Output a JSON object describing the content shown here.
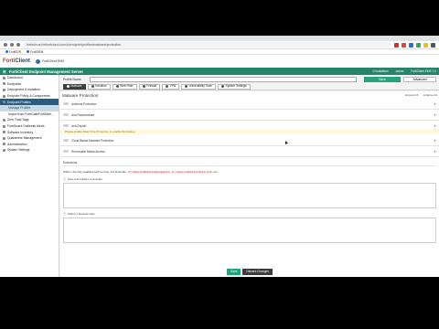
{
  "browser": {
    "url": "fortiedr.us.fortinetcloud.com/#/endpoint/profiles/malware/protection",
    "bookmarks": [
      "FortiEDR",
      "FortiSIEM"
    ]
  },
  "app": {
    "logo_prefix": "Forti",
    "logo_suffix": "Client",
    "ems_pill": "FortiClient EMS",
    "title": "FortiClient Endpoint Management Server",
    "header_right": [
      "0 Invitations",
      "admin",
      "FortiClient EMS 7.0"
    ]
  },
  "sidebar": {
    "items": [
      {
        "label": "Dashboard",
        "type": "item"
      },
      {
        "label": "Endpoints",
        "type": "item"
      },
      {
        "label": "Deployment & Installers",
        "type": "item"
      },
      {
        "label": "Endpoint Policy & Components",
        "type": "item"
      },
      {
        "label": "Endpoint Profiles",
        "type": "active"
      },
      {
        "label": "Manage Profiles",
        "type": "selected"
      },
      {
        "label": "Import from FortiGate/FortiMan...",
        "type": "sub"
      },
      {
        "label": "Zero Trust Tags",
        "type": "item"
      },
      {
        "label": "FortiGuard Outbreak Alerts",
        "type": "item"
      },
      {
        "label": "Software Inventory",
        "type": "item"
      },
      {
        "label": "Quarantine Management",
        "type": "item"
      },
      {
        "label": "Administration",
        "type": "item"
      },
      {
        "label": "System Settings",
        "type": "item"
      }
    ]
  },
  "profile": {
    "name_label": "Profile Name",
    "save_label": "Save",
    "advanced_label": "Advanced"
  },
  "tabs": [
    {
      "label": "Malware",
      "active": true
    },
    {
      "label": "Sandbox",
      "active": false
    },
    {
      "label": "Web Filter",
      "active": false
    },
    {
      "label": "Firewall",
      "active": false
    },
    {
      "label": "VPN",
      "active": false
    },
    {
      "label": "Vulnerability Scan",
      "active": false
    },
    {
      "label": "System Settings",
      "active": false
    }
  ],
  "panel": {
    "title": "Malware Protection",
    "links": [
      "Expand All",
      "Collapse All"
    ],
    "rows": [
      "Antivirus Protection",
      "Anti-Ransomware",
      "Anti-Exploit",
      "Cloud Based Malware Protection",
      "Removable Media Access"
    ],
    "info_note": "Please enable Real-Time Protection to enable this feature"
  },
  "exclusions": {
    "title": "Exclusions",
    "note_prefix": "Paths: Use fully qualified path per line. For Example:",
    "example1": "C:\\Users\\Public\\Documents",
    "example2": "C:\\Users\\Public\\file.txt",
    "note_suffix": "etc.",
    "field1": "Files and Folders to Exclude",
    "field2": "Paths to Exclude Files"
  },
  "footer": {
    "save": "Save",
    "discard": "Discard Changes"
  }
}
